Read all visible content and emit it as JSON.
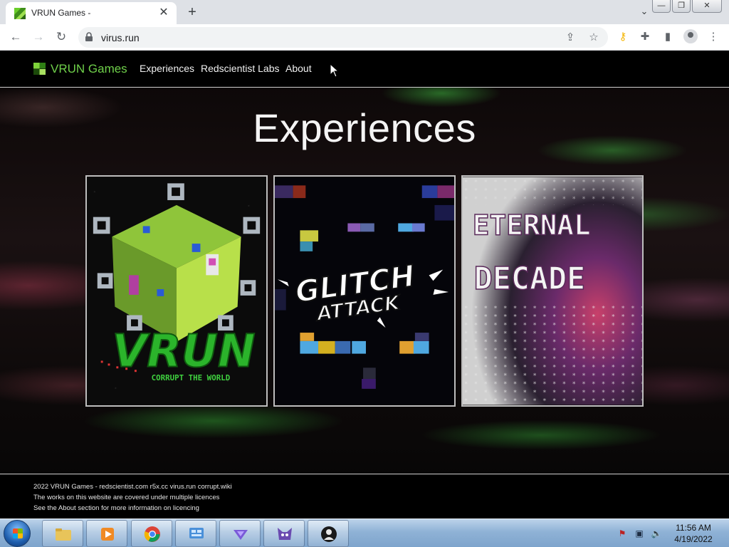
{
  "browser": {
    "tab_title": "VRUN Games -",
    "tab_close": "✕",
    "new_tab": "+",
    "url": "virus.run",
    "tab_search_icon": "chevron-down-icon",
    "window_buttons": {
      "minimize": "—",
      "restore": "❐",
      "close": "✕"
    }
  },
  "site": {
    "brand": "VRUN Games",
    "nav": [
      "Experiences",
      "Redscientist Labs",
      "About"
    ],
    "title": "Experiences",
    "cards": [
      {
        "art_text": "VRUN",
        "art_subtext": "CORRUPT THE WORLD"
      },
      {
        "art_text": "GLITCH",
        "art_subtext": "ATTACK"
      },
      {
        "art_text": "ETERNAL",
        "art_subtext": "DECADE"
      }
    ],
    "footer": [
      "2022 VRUN Games - redscientist.com r5x.cc virus.run corrupt.wiki",
      "The works on this website are covered under multiple licences",
      "See the About section for more information on licencing"
    ]
  },
  "taskbar": {
    "time": "11:56 AM",
    "date": "4/19/2022"
  }
}
